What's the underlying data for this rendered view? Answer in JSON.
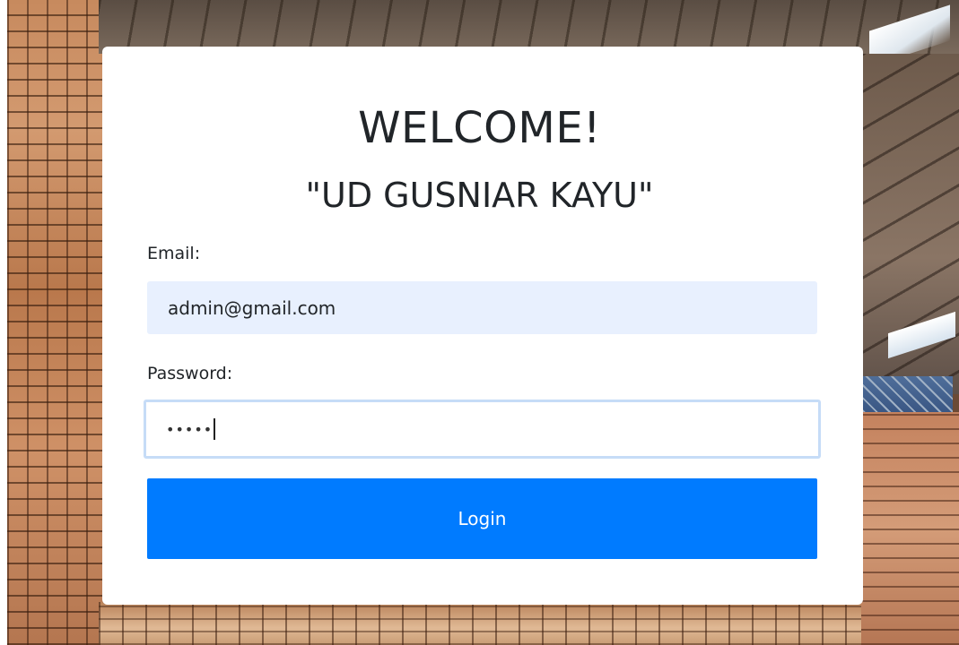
{
  "card": {
    "title": "WELCOME!",
    "subtitle": "\"UD GUSNIAR KAYU\""
  },
  "form": {
    "email_label": "Email:",
    "email_value": "admin@gmail.com",
    "password_label": "Password:",
    "password_mask": "•••••",
    "login_label": "Login"
  },
  "colors": {
    "button_bg": "#007bff",
    "email_autofill_bg": "#e8f0fe",
    "focus_border": "#c6dcf7"
  }
}
